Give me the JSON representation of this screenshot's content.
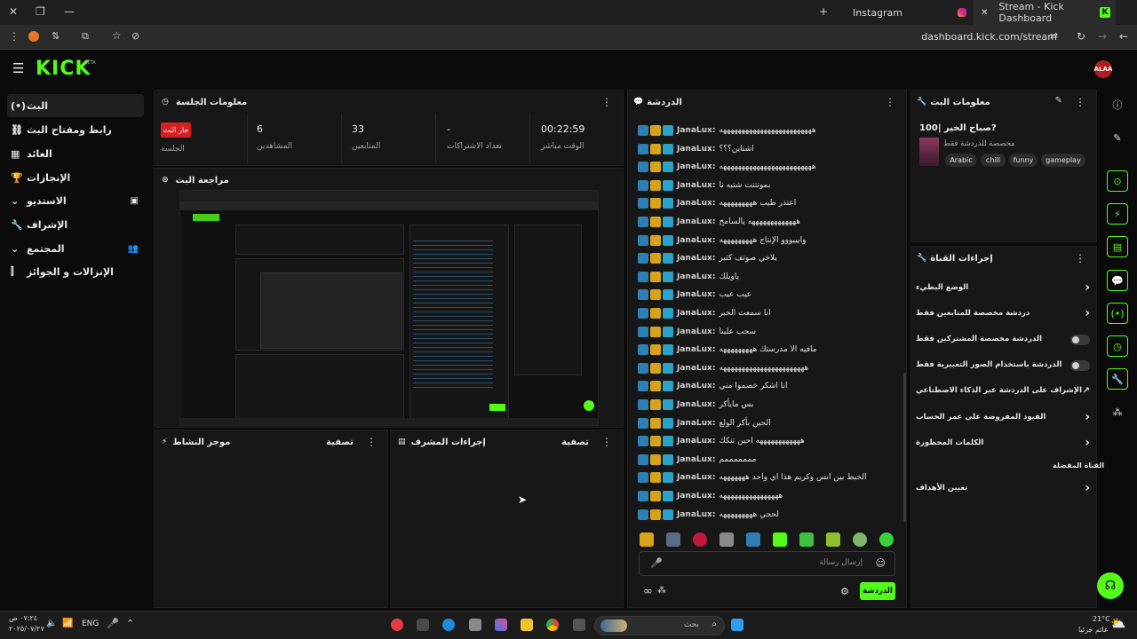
{
  "browser": {
    "tabs": [
      {
        "label": "Instagram"
      },
      {
        "label": "Stream - Kick Dashboard"
      }
    ],
    "url": "dashboard.kick.com/stream",
    "new_tab": "+"
  },
  "site": {
    "logo": "KICK",
    "beta": "BETA",
    "avatar": "ALAA"
  },
  "nav": {
    "items": [
      {
        "label": "البث",
        "icon": "(•)"
      },
      {
        "label": "رابط ومفتاح البث",
        "icon": "⛓"
      },
      {
        "label": "العائد",
        "icon": "▦"
      },
      {
        "label": "الإنجازات",
        "icon": "🏆"
      },
      {
        "label": "الاستديو",
        "icon": "⌄"
      },
      {
        "label": "الإشراف",
        "icon": "🔧"
      },
      {
        "label": "المجتمع",
        "icon": "⌄"
      },
      {
        "label": "الإنزالات و الجوائز",
        "icon": "⫿"
      }
    ]
  },
  "session": {
    "title": "معلومات الجلسة",
    "live_badge": "جار البث",
    "stats": [
      {
        "value": "",
        "label": "الجلسة"
      },
      {
        "value": "6",
        "label": "المشاهدين"
      },
      {
        "value": "33",
        "label": "المتابعين"
      },
      {
        "value": "-",
        "label": "تعداد الاشتراكات"
      },
      {
        "value": "00:22:59",
        "label": "الوقت مباشر"
      }
    ]
  },
  "preview": {
    "title": "مراجعة البث"
  },
  "activity": {
    "title": "موجز النشاط",
    "filter": "تصفية"
  },
  "modactions": {
    "title": "إجراءات المشرف",
    "filter": "تصفية"
  },
  "chat": {
    "title": "الدردشة",
    "messages": [
      {
        "user": "JanaLux:",
        "text": "هههههههههههههههههههههههههه"
      },
      {
        "user": "JanaLux:",
        "text": "اشتاين؟؟؟"
      },
      {
        "user": "JanaLux:",
        "text": "هههههههههههههههههههههههههه"
      },
      {
        "user": "JanaLux:",
        "text": "بموتتتت شتبه نا"
      },
      {
        "user": "JanaLux:",
        "text": "اعتذر طيب هههههههههه"
      },
      {
        "user": "JanaLux:",
        "text": "هههههههههههههه يالسامح"
      },
      {
        "user": "JanaLux:",
        "text": "وايييووو الإنتاج هههههههههه"
      },
      {
        "user": "JanaLux:",
        "text": "يلاخي صوتف كثير"
      },
      {
        "user": "JanaLux:",
        "text": "ياويلك"
      },
      {
        "user": "JanaLux:",
        "text": "عيب عيب"
      },
      {
        "user": "JanaLux:",
        "text": "انا سمعت الخبر"
      },
      {
        "user": "JanaLux:",
        "text": "سحب علينا"
      },
      {
        "user": "JanaLux:",
        "text": "مافيه الا مدرستك هههههههههه"
      },
      {
        "user": "JanaLux:",
        "text": "هههههههههههههههههههههههه"
      },
      {
        "user": "JanaLux:",
        "text": "انا اشكر خصموا مني"
      },
      {
        "user": "JanaLux:",
        "text": "بس مايأكر"
      },
      {
        "user": "JanaLux:",
        "text": "الحين بأكر الولع"
      },
      {
        "user": "JanaLux:",
        "text": "ههههههههههههه احين تنكك"
      },
      {
        "user": "JanaLux:",
        "text": "مممممممم"
      },
      {
        "user": "JanaLux:",
        "text": "الخبط بين انس وكريم هذا اي واحد هههههههه"
      },
      {
        "user": "JanaLux:",
        "text": "ههههههههههههههههه"
      },
      {
        "user": "JanaLux:",
        "text": "لحجي هههههههههه"
      }
    ],
    "input_placeholder": "إرسال رسالة",
    "send": "الدردشة"
  },
  "streaminfo": {
    "title": "معلومات البث",
    "stream_title": "صباح الخير |100?",
    "subtitle": "مخصصة للدردشة فقط",
    "tags": [
      "Arabic",
      "chill",
      "funny",
      "gameplay"
    ]
  },
  "channel": {
    "title": "إجراءات القناة",
    "rows": [
      {
        "label": "الوضع البطيء",
        "control": "chevron"
      },
      {
        "label": "دردشة مخصصة للمتابعين فقط",
        "control": "chevron"
      },
      {
        "label": "الدردشة مخصصة المشتركين فقط",
        "control": "toggle"
      },
      {
        "label": "الدردشة باستخدام الصور التعبيرية فقط",
        "control": "toggle"
      },
      {
        "label": "الإشراف على الدردشة عبر الذكاء الاصطناعي",
        "control": "external"
      },
      {
        "label": "القيود المفروضة على عمر الحساب",
        "control": "chevron"
      },
      {
        "label": "الكلمات المحظورة",
        "control": "chevron"
      }
    ],
    "section2": "القناة المفضلة",
    "goals": "تعيين الأهداف"
  },
  "taskbar": {
    "time": "٠٧:٢٤ ص",
    "date": "٢٠٢٥/٠٧/٢٧",
    "lang": "ENG",
    "search": "بحث",
    "weather_temp": "21°C",
    "weather_desc": "غائم جزئيا"
  },
  "colors": {
    "accent": "#53fc18",
    "live": "#d42020"
  }
}
